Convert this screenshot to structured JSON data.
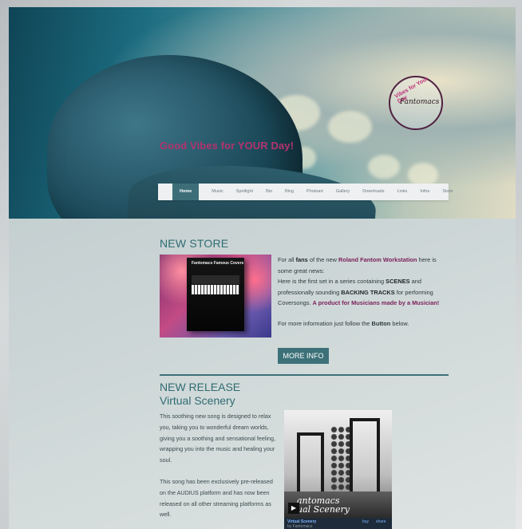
{
  "hero": {
    "tagline": "Good Vibes for YOUR Day!",
    "logo_text": "Fantomacs",
    "logo_ring": "Vibes for Your Day"
  },
  "nav": {
    "items": [
      "Home",
      "Music",
      "Spotlight",
      "Bio",
      "Blog",
      "Photoart",
      "Gallery",
      "Downloads",
      "Links",
      "Infos",
      "Store"
    ],
    "active": "Home"
  },
  "store": {
    "heading": "NEW STORE",
    "product_title": "Fantomacs Famous Covers",
    "p1_a": "For all ",
    "p1_fans": "fans",
    "p1_b": " of the new ",
    "p1_product": "Roland Fantom Workstation",
    "p1_c": " here is some great news:",
    "p2_a": "Here is the first set in a series containing ",
    "p2_scenes": "SCENES",
    "p2_b": " and professionally sounding ",
    "p2_tracks": "BACKING TRACKS",
    "p2_c": " for performing Coversongs. ",
    "p2_accent": "A product for Musicians made by a Musician!",
    "info_a": "For more information just follow the ",
    "info_button": "Button",
    "info_b": " below.",
    "button_label": "MORE INFO"
  },
  "release": {
    "heading": "NEW RELEASE",
    "subheading": "Virtual Scenery",
    "p1": "This soothing new song is designed to relax you, taking you to wonderful dream worlds, giving you a soothing and sensational feeling, wrapping you into the music and healing your soul.",
    "p2": "This song has been exclusively pre-released on the AUDIUS platform and has now been released on all other streaming platforms as well.",
    "player": {
      "art_line1": "antomacs",
      "art_line2": "ual Scenery",
      "track_title": "Virtual Scenery",
      "track_sub": "by Fantomacs",
      "buy_label": "buy",
      "share_label": "share"
    }
  }
}
